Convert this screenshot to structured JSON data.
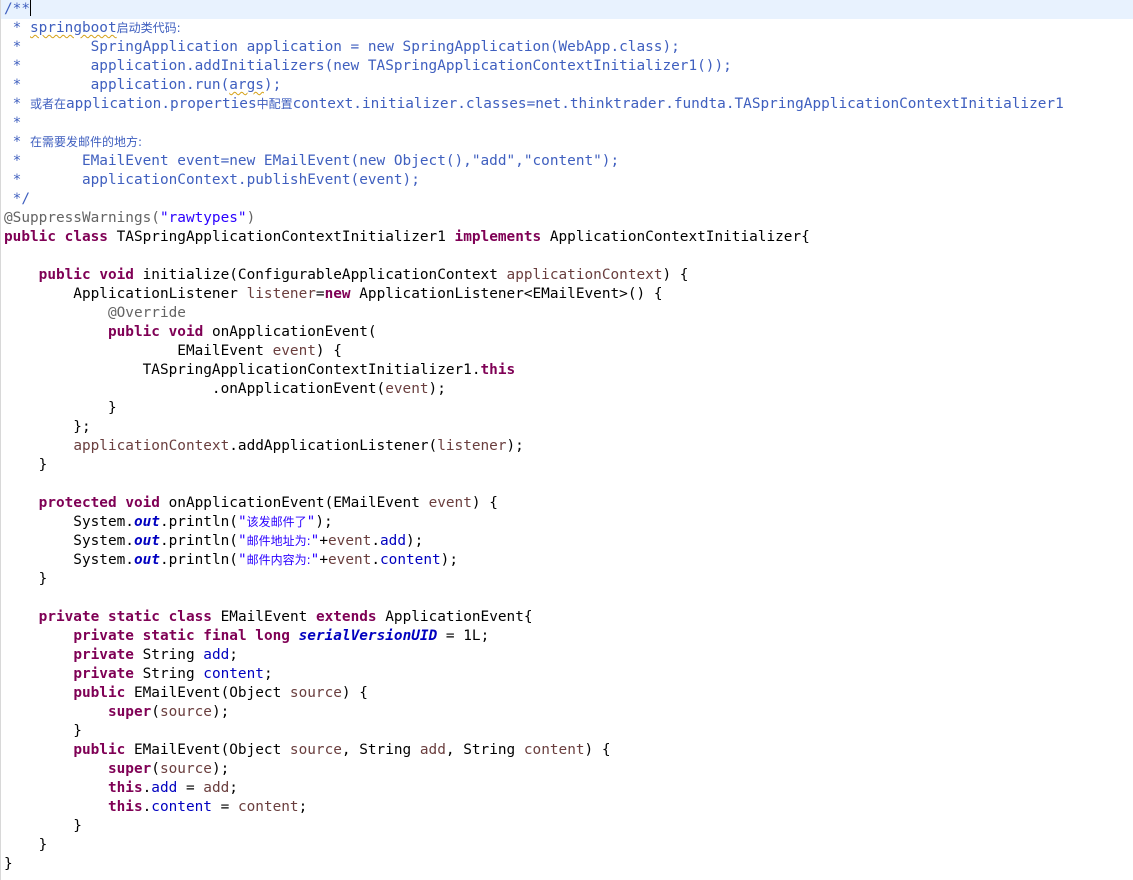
{
  "editor": {
    "lines": [
      {
        "tokens": [
          {
            "t": "/**",
            "c": "cm"
          }
        ],
        "current": true
      },
      {
        "tokens": [
          {
            "t": " * ",
            "c": "cm"
          },
          {
            "t": "springboot",
            "c": "cm",
            "u": true
          },
          {
            "t": "启动类代码:",
            "c": "cm cjk"
          }
        ]
      },
      {
        "tokens": [
          {
            "t": " *        SpringApplication application = new SpringApplication(WebApp.class);",
            "c": "cm"
          }
        ]
      },
      {
        "tokens": [
          {
            "t": " *        application.addInitializers(new TASpringApplicationContextInitializer1());",
            "c": "cm"
          }
        ]
      },
      {
        "tokens": [
          {
            "t": " *        application.run(",
            "c": "cm"
          },
          {
            "t": "args",
            "c": "cm",
            "u": true
          },
          {
            "t": ");",
            "c": "cm"
          }
        ]
      },
      {
        "tokens": [
          {
            "t": " * ",
            "c": "cm"
          },
          {
            "t": "或者在",
            "c": "cm cjk"
          },
          {
            "t": "application.properties",
            "c": "cm"
          },
          {
            "t": "中配置",
            "c": "cm cjk"
          },
          {
            "t": "context.initializer.classes=net.thinktrader.fundta.TASpringApplicationContextInitializer1",
            "c": "cm"
          }
        ]
      },
      {
        "tokens": [
          {
            "t": " *",
            "c": "cm"
          }
        ]
      },
      {
        "tokens": [
          {
            "t": " * ",
            "c": "cm"
          },
          {
            "t": "在需要发邮件的地方:",
            "c": "cm cjk"
          }
        ]
      },
      {
        "tokens": [
          {
            "t": " *       EMailEvent event=new EMailEvent(new Object(),\"add\",\"content\");",
            "c": "cm"
          }
        ]
      },
      {
        "tokens": [
          {
            "t": " *       applicationContext.publishEvent(event);",
            "c": "cm"
          }
        ]
      },
      {
        "tokens": [
          {
            "t": " */",
            "c": "cm"
          }
        ]
      },
      {
        "tokens": [
          {
            "t": "@SuppressWarnings(",
            "c": "ann"
          },
          {
            "t": "\"rawtypes\"",
            "c": "str"
          },
          {
            "t": ")",
            "c": "ann"
          }
        ]
      },
      {
        "tokens": [
          {
            "t": "public",
            "c": "kw"
          },
          {
            "t": " "
          },
          {
            "t": "class",
            "c": "kw"
          },
          {
            "t": " TASpringApplicationContextInitializer1 "
          },
          {
            "t": "implements",
            "c": "kw"
          },
          {
            "t": " ApplicationContextInitializer{"
          }
        ]
      },
      {
        "tokens": []
      },
      {
        "tokens": [
          {
            "t": "    "
          },
          {
            "t": "public",
            "c": "kw"
          },
          {
            "t": " "
          },
          {
            "t": "void",
            "c": "kw"
          },
          {
            "t": " initialize(ConfigurableApplicationContext "
          },
          {
            "t": "applicationContext",
            "c": "par"
          },
          {
            "t": ") {"
          }
        ]
      },
      {
        "tokens": [
          {
            "t": "        ApplicationListener "
          },
          {
            "t": "listener",
            "c": "par"
          },
          {
            "t": "="
          },
          {
            "t": "new",
            "c": "kw"
          },
          {
            "t": " ApplicationListener<EMailEvent>() {"
          }
        ]
      },
      {
        "tokens": [
          {
            "t": "            "
          },
          {
            "t": "@Override",
            "c": "ann"
          }
        ]
      },
      {
        "tokens": [
          {
            "t": "            "
          },
          {
            "t": "public",
            "c": "kw"
          },
          {
            "t": " "
          },
          {
            "t": "void",
            "c": "kw"
          },
          {
            "t": " onApplicationEvent("
          }
        ]
      },
      {
        "tokens": [
          {
            "t": "                    EMailEvent "
          },
          {
            "t": "event",
            "c": "par"
          },
          {
            "t": ") {"
          }
        ]
      },
      {
        "tokens": [
          {
            "t": "                TASpringApplicationContextInitializer1."
          },
          {
            "t": "this",
            "c": "kw"
          }
        ]
      },
      {
        "tokens": [
          {
            "t": "                        .onApplicationEvent("
          },
          {
            "t": "event",
            "c": "par"
          },
          {
            "t": ");"
          }
        ]
      },
      {
        "tokens": [
          {
            "t": "            }"
          }
        ]
      },
      {
        "tokens": [
          {
            "t": "        };"
          }
        ]
      },
      {
        "tokens": [
          {
            "t": "        "
          },
          {
            "t": "applicationContext",
            "c": "par"
          },
          {
            "t": ".addApplicationListener("
          },
          {
            "t": "listener",
            "c": "par"
          },
          {
            "t": ");"
          }
        ]
      },
      {
        "tokens": [
          {
            "t": "    }"
          }
        ]
      },
      {
        "tokens": []
      },
      {
        "tokens": [
          {
            "t": "    "
          },
          {
            "t": "protected",
            "c": "kw"
          },
          {
            "t": " "
          },
          {
            "t": "void",
            "c": "kw"
          },
          {
            "t": " onApplicationEvent(EMailEvent "
          },
          {
            "t": "event",
            "c": "par"
          },
          {
            "t": ") {"
          }
        ]
      },
      {
        "tokens": [
          {
            "t": "        System."
          },
          {
            "t": "out",
            "c": "stat"
          },
          {
            "t": ".println("
          },
          {
            "t": "\"",
            "c": "str"
          },
          {
            "t": "该发邮件了",
            "c": "str cjk"
          },
          {
            "t": "\"",
            "c": "str"
          },
          {
            "t": ");"
          }
        ]
      },
      {
        "tokens": [
          {
            "t": "        System."
          },
          {
            "t": "out",
            "c": "stat"
          },
          {
            "t": ".println("
          },
          {
            "t": "\"",
            "c": "str"
          },
          {
            "t": "邮件地址为:",
            "c": "str cjk"
          },
          {
            "t": "\"",
            "c": "str"
          },
          {
            "t": "+"
          },
          {
            "t": "event",
            "c": "par"
          },
          {
            "t": "."
          },
          {
            "t": "add",
            "c": "fld"
          },
          {
            "t": ");"
          }
        ]
      },
      {
        "tokens": [
          {
            "t": "        System."
          },
          {
            "t": "out",
            "c": "stat"
          },
          {
            "t": ".println("
          },
          {
            "t": "\"",
            "c": "str"
          },
          {
            "t": "邮件内容为:",
            "c": "str cjk"
          },
          {
            "t": "\"",
            "c": "str"
          },
          {
            "t": "+"
          },
          {
            "t": "event",
            "c": "par"
          },
          {
            "t": "."
          },
          {
            "t": "content",
            "c": "fld"
          },
          {
            "t": ");"
          }
        ]
      },
      {
        "tokens": [
          {
            "t": "    }"
          }
        ]
      },
      {
        "tokens": []
      },
      {
        "tokens": [
          {
            "t": "    "
          },
          {
            "t": "private",
            "c": "kw"
          },
          {
            "t": " "
          },
          {
            "t": "static",
            "c": "kw"
          },
          {
            "t": " "
          },
          {
            "t": "class",
            "c": "kw"
          },
          {
            "t": " EMailEvent "
          },
          {
            "t": "extends",
            "c": "kw"
          },
          {
            "t": " ApplicationEvent{"
          }
        ]
      },
      {
        "tokens": [
          {
            "t": "        "
          },
          {
            "t": "private",
            "c": "kw"
          },
          {
            "t": " "
          },
          {
            "t": "static",
            "c": "kw"
          },
          {
            "t": " "
          },
          {
            "t": "final",
            "c": "kw"
          },
          {
            "t": " "
          },
          {
            "t": "long",
            "c": "kw"
          },
          {
            "t": " "
          },
          {
            "t": "serialVersionUID",
            "c": "sfld"
          },
          {
            "t": " = 1L;"
          }
        ]
      },
      {
        "tokens": [
          {
            "t": "        "
          },
          {
            "t": "private",
            "c": "kw"
          },
          {
            "t": " String "
          },
          {
            "t": "add",
            "c": "fld"
          },
          {
            "t": ";"
          }
        ]
      },
      {
        "tokens": [
          {
            "t": "        "
          },
          {
            "t": "private",
            "c": "kw"
          },
          {
            "t": " String "
          },
          {
            "t": "content",
            "c": "fld"
          },
          {
            "t": ";"
          }
        ]
      },
      {
        "tokens": [
          {
            "t": "        "
          },
          {
            "t": "public",
            "c": "kw"
          },
          {
            "t": " EMailEvent(Object "
          },
          {
            "t": "source",
            "c": "par"
          },
          {
            "t": ") {"
          }
        ]
      },
      {
        "tokens": [
          {
            "t": "            "
          },
          {
            "t": "super",
            "c": "kw"
          },
          {
            "t": "("
          },
          {
            "t": "source",
            "c": "par"
          },
          {
            "t": ");"
          }
        ]
      },
      {
        "tokens": [
          {
            "t": "        }"
          }
        ]
      },
      {
        "tokens": [
          {
            "t": "        "
          },
          {
            "t": "public",
            "c": "kw"
          },
          {
            "t": " EMailEvent(Object "
          },
          {
            "t": "source",
            "c": "par"
          },
          {
            "t": ", String "
          },
          {
            "t": "add",
            "c": "par"
          },
          {
            "t": ", String "
          },
          {
            "t": "content",
            "c": "par"
          },
          {
            "t": ") {"
          }
        ]
      },
      {
        "tokens": [
          {
            "t": "            "
          },
          {
            "t": "super",
            "c": "kw"
          },
          {
            "t": "("
          },
          {
            "t": "source",
            "c": "par"
          },
          {
            "t": ");"
          }
        ]
      },
      {
        "tokens": [
          {
            "t": "            "
          },
          {
            "t": "this",
            "c": "kw"
          },
          {
            "t": "."
          },
          {
            "t": "add",
            "c": "fld"
          },
          {
            "t": " = "
          },
          {
            "t": "add",
            "c": "par"
          },
          {
            "t": ";"
          }
        ]
      },
      {
        "tokens": [
          {
            "t": "            "
          },
          {
            "t": "this",
            "c": "kw"
          },
          {
            "t": "."
          },
          {
            "t": "content",
            "c": "fld"
          },
          {
            "t": " = "
          },
          {
            "t": "content",
            "c": "par"
          },
          {
            "t": ";"
          }
        ]
      },
      {
        "tokens": [
          {
            "t": "        }"
          }
        ]
      },
      {
        "tokens": [
          {
            "t": "    }"
          }
        ]
      },
      {
        "tokens": [
          {
            "t": "}"
          }
        ]
      }
    ]
  }
}
